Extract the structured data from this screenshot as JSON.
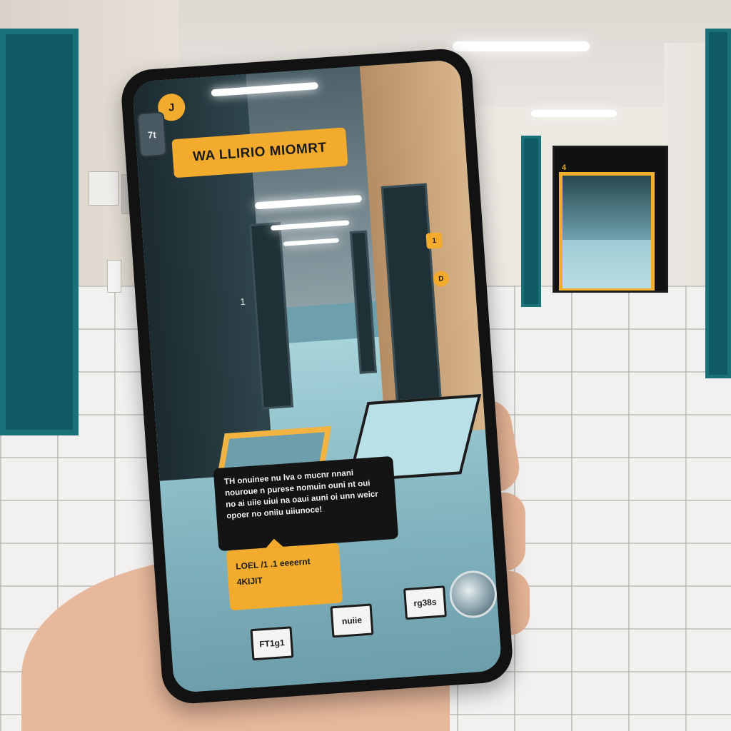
{
  "ar_app": {
    "title_banner": "WA LLIRIO MIOMRT",
    "top_badge": "J",
    "side_badge": "7t",
    "wall_number": "1",
    "right_tag_upper": "1",
    "right_tag_lower": "D",
    "info_bubble": {
      "lines": [
        "TH onuinee nu lva o mucnr nnani",
        "nouroue n purese nomuin ouni nt oui",
        "no ai uiie uiui na oaui auni oi unn weicr",
        "opoer no oniiu uiiunoce!"
      ]
    },
    "location_card": {
      "line1": "LOEL /1 .1 eeeernt",
      "line2": "4KIJIT"
    },
    "nav_buttons": [
      "FT1g1",
      "nuiie",
      "rg38s"
    ]
  },
  "floating_card": {
    "badge": "4"
  },
  "colors": {
    "accent": "#f3ab2e",
    "floor": "#7fb2bd",
    "door": "#0f5a63",
    "bubble": "#141414"
  }
}
